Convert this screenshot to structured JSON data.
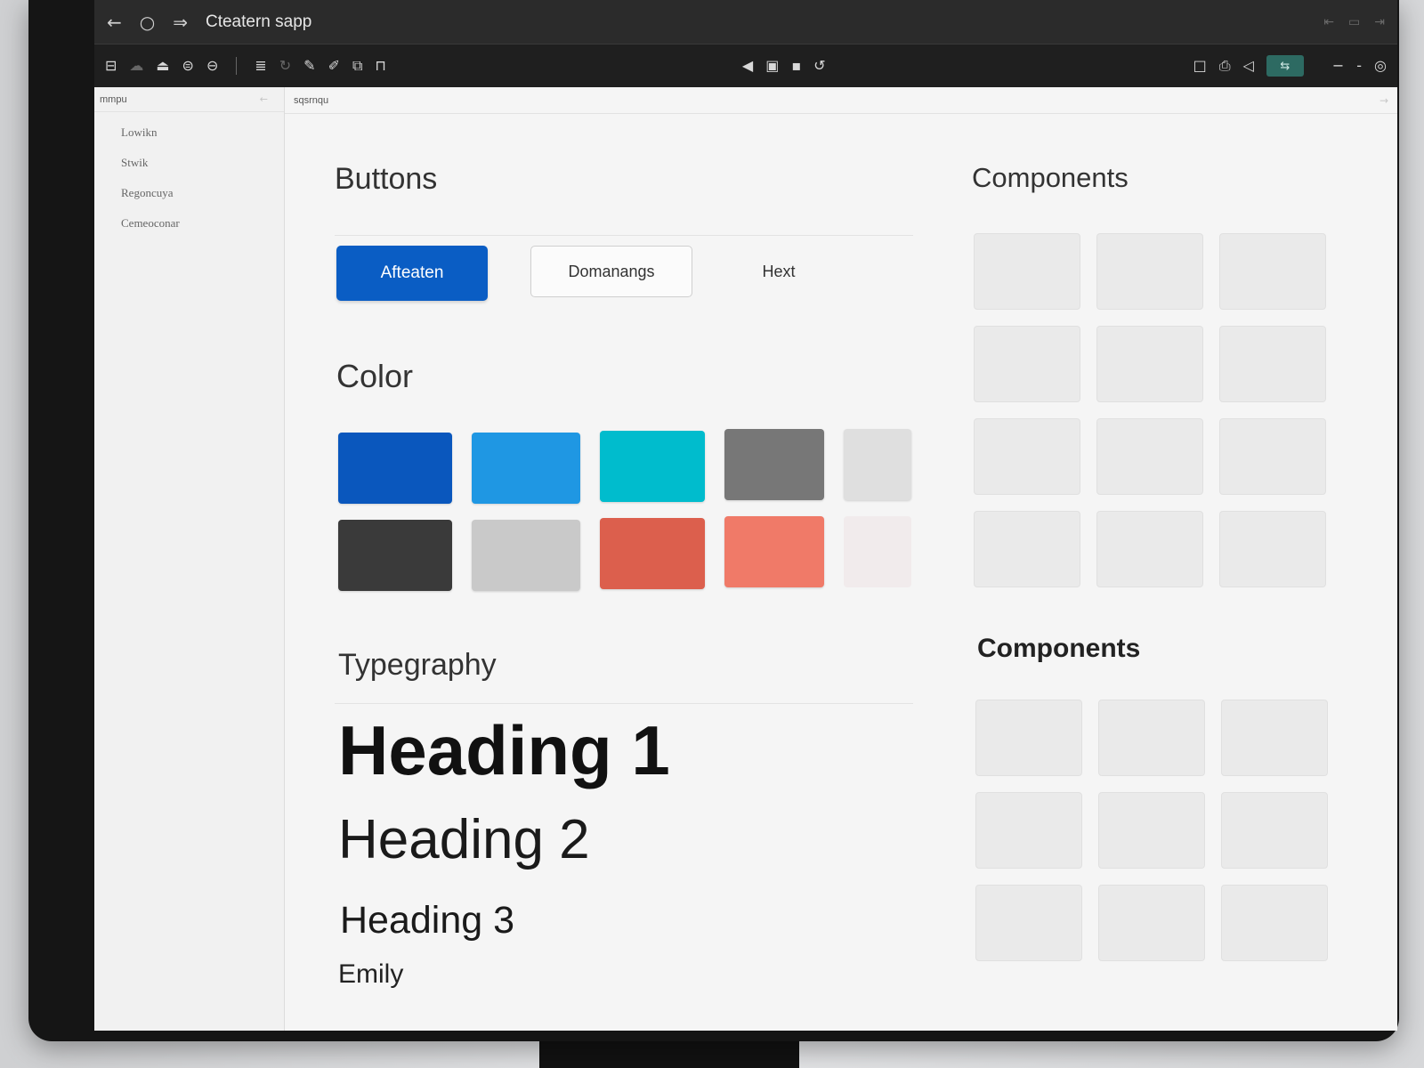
{
  "window": {
    "title": "Cteatern sapp"
  },
  "titlebar_icons": [
    "back-arrow-icon",
    "refresh-icon",
    "forward-arrow-icon"
  ],
  "toolbar": {
    "left_icons": [
      "layers-icon",
      "cloud-icon",
      "upload-icon",
      "stack-icon",
      "database-icon",
      "list-icon",
      "history-icon",
      "pen-icon",
      "brush-icon",
      "frame-icon",
      "lock-icon"
    ],
    "center_icons": [
      "speaker-icon",
      "display-icon",
      "save-icon",
      "link-icon"
    ],
    "right_icons": [
      "square-icon",
      "printer-icon",
      "volume-icon"
    ],
    "accent_button_glyph": "⇆"
  },
  "sidebar": {
    "header": "mmpu",
    "items": [
      {
        "label": "Lowikn"
      },
      {
        "label": "Stwik"
      },
      {
        "label": "Regoncuya"
      },
      {
        "label": "Cemeoconar"
      }
    ]
  },
  "breadcrumb": {
    "label": "sqsrnqu"
  },
  "buttons_section": {
    "title": "Buttons",
    "primary_label": "Afteaten",
    "secondary_label": "Domanangs",
    "text_label": "Hext"
  },
  "color_section": {
    "title": "Color",
    "swatches": [
      "#0a57bd",
      "#1f97e3",
      "#00bccd",
      "#777777",
      "#dfdfdf",
      "#3a3a3a",
      "#c9c9c9",
      "#dc5f4d",
      "#f07a68",
      "#f1ebec"
    ]
  },
  "typography_section": {
    "title": "Typegraphy",
    "h1": "Heading 1",
    "h2": "Heading 2",
    "h3": "Heading 3",
    "body": "Emily"
  },
  "components_top": {
    "title": "Components",
    "tile_count": 12
  },
  "components_bottom": {
    "title": "Components",
    "tile_count": 9
  }
}
